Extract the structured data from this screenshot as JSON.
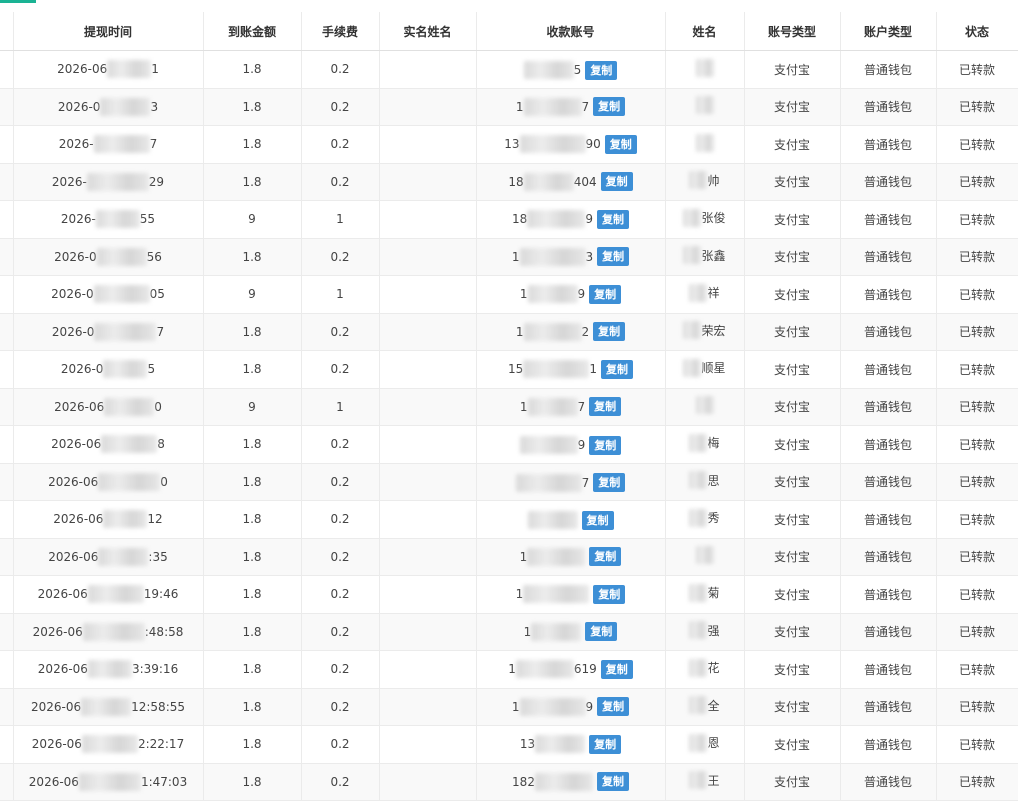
{
  "colors": {
    "accent": "#1ab394",
    "copy_button": "#3d8fd6"
  },
  "table": {
    "headers": [
      "提现时间",
      "到账金额",
      "手续费",
      "实名姓名",
      "收款账号",
      "姓名",
      "账号类型",
      "账户类型",
      "状态"
    ],
    "copy_label": "复制",
    "rows": [
      {
        "time_prefix": "2026-06",
        "time_suffix": "1",
        "amount": "1.8",
        "fee": "0.2",
        "real_name": "",
        "account_prefix": "",
        "account_suffix": "5",
        "name": "",
        "account_type": "支付宝",
        "wallet_type": "普通钱包",
        "status": "已转款"
      },
      {
        "time_prefix": "2026-0",
        "time_suffix": "3",
        "amount": "1.8",
        "fee": "0.2",
        "real_name": "",
        "account_prefix": "1",
        "account_suffix": "7",
        "name": "",
        "account_type": "支付宝",
        "wallet_type": "普通钱包",
        "status": "已转款"
      },
      {
        "time_prefix": "2026-",
        "time_suffix": "7",
        "amount": "1.8",
        "fee": "0.2",
        "real_name": "",
        "account_prefix": "13",
        "account_suffix": "90",
        "name": "",
        "account_type": "支付宝",
        "wallet_type": "普通钱包",
        "status": "已转款"
      },
      {
        "time_prefix": "2026-",
        "time_suffix": "29",
        "amount": "1.8",
        "fee": "0.2",
        "real_name": "",
        "account_prefix": "18",
        "account_suffix": "404",
        "name": "帅",
        "account_type": "支付宝",
        "wallet_type": "普通钱包",
        "status": "已转款"
      },
      {
        "time_prefix": "2026-",
        "time_suffix": "55",
        "amount": "9",
        "fee": "1",
        "real_name": "",
        "account_prefix": "18",
        "account_suffix": "9",
        "name": "张俊",
        "account_type": "支付宝",
        "wallet_type": "普通钱包",
        "status": "已转款"
      },
      {
        "time_prefix": "2026-0",
        "time_suffix": "56",
        "amount": "1.8",
        "fee": "0.2",
        "real_name": "",
        "account_prefix": "1",
        "account_suffix": "3",
        "name": "张鑫",
        "account_type": "支付宝",
        "wallet_type": "普通钱包",
        "status": "已转款"
      },
      {
        "time_prefix": "2026-0",
        "time_suffix": "05",
        "amount": "9",
        "fee": "1",
        "real_name": "",
        "account_prefix": "1",
        "account_suffix": "9",
        "name": "祥",
        "account_type": "支付宝",
        "wallet_type": "普通钱包",
        "status": "已转款"
      },
      {
        "time_prefix": "2026-0",
        "time_suffix": "7",
        "amount": "1.8",
        "fee": "0.2",
        "real_name": "",
        "account_prefix": "1",
        "account_suffix": "2",
        "name": "荣宏",
        "account_type": "支付宝",
        "wallet_type": "普通钱包",
        "status": "已转款"
      },
      {
        "time_prefix": "2026-0",
        "time_suffix": "5",
        "amount": "1.8",
        "fee": "0.2",
        "real_name": "",
        "account_prefix": "15",
        "account_suffix": "1",
        "name": "顺星",
        "account_type": "支付宝",
        "wallet_type": "普通钱包",
        "status": "已转款"
      },
      {
        "time_prefix": "2026-06",
        "time_suffix": "0",
        "amount": "9",
        "fee": "1",
        "real_name": "",
        "account_prefix": "1",
        "account_suffix": "7",
        "name": "",
        "account_type": "支付宝",
        "wallet_type": "普通钱包",
        "status": "已转款"
      },
      {
        "time_prefix": "2026-06",
        "time_suffix": "8",
        "amount": "1.8",
        "fee": "0.2",
        "real_name": "",
        "account_prefix": "",
        "account_suffix": "9",
        "name": "梅",
        "account_type": "支付宝",
        "wallet_type": "普通钱包",
        "status": "已转款"
      },
      {
        "time_prefix": "2026-06",
        "time_suffix": "0",
        "amount": "1.8",
        "fee": "0.2",
        "real_name": "",
        "account_prefix": "",
        "account_suffix": "7",
        "name": "思",
        "account_type": "支付宝",
        "wallet_type": "普通钱包",
        "status": "已转款"
      },
      {
        "time_prefix": "2026-06",
        "time_suffix": "12",
        "amount": "1.8",
        "fee": "0.2",
        "real_name": "",
        "account_prefix": "",
        "account_suffix": "",
        "name": "秀",
        "account_type": "支付宝",
        "wallet_type": "普通钱包",
        "status": "已转款"
      },
      {
        "time_prefix": "2026-06",
        "time_suffix": ":35",
        "amount": "1.8",
        "fee": "0.2",
        "real_name": "",
        "account_prefix": "1",
        "account_suffix": "",
        "name": "",
        "account_type": "支付宝",
        "wallet_type": "普通钱包",
        "status": "已转款"
      },
      {
        "time_prefix": "2026-06",
        "time_suffix": "19:46",
        "amount": "1.8",
        "fee": "0.2",
        "real_name": "",
        "account_prefix": "1",
        "account_suffix": "",
        "name": "菊",
        "account_type": "支付宝",
        "wallet_type": "普通钱包",
        "status": "已转款"
      },
      {
        "time_prefix": "2026-06",
        "time_suffix": ":48:58",
        "amount": "1.8",
        "fee": "0.2",
        "real_name": "",
        "account_prefix": "1",
        "account_suffix": "",
        "name": "强",
        "account_type": "支付宝",
        "wallet_type": "普通钱包",
        "status": "已转款"
      },
      {
        "time_prefix": "2026-06",
        "time_suffix": "3:39:16",
        "amount": "1.8",
        "fee": "0.2",
        "real_name": "",
        "account_prefix": "1",
        "account_suffix": "619",
        "name": "花",
        "account_type": "支付宝",
        "wallet_type": "普通钱包",
        "status": "已转款"
      },
      {
        "time_prefix": "2026-06",
        "time_suffix": "12:58:55",
        "amount": "1.8",
        "fee": "0.2",
        "real_name": "",
        "account_prefix": "1",
        "account_suffix": "9",
        "name": "全",
        "account_type": "支付宝",
        "wallet_type": "普通钱包",
        "status": "已转款"
      },
      {
        "time_prefix": "2026-06",
        "time_suffix": "2:22:17",
        "amount": "1.8",
        "fee": "0.2",
        "real_name": "",
        "account_prefix": "13",
        "account_suffix": "",
        "name": "恩",
        "account_type": "支付宝",
        "wallet_type": "普通钱包",
        "status": "已转款"
      },
      {
        "time_prefix": "2026-06",
        "time_suffix": "1:47:03",
        "amount": "1.8",
        "fee": "0.2",
        "real_name": "",
        "account_prefix": "182",
        "account_suffix": "",
        "name": "王",
        "account_type": "支付宝",
        "wallet_type": "普通钱包",
        "status": "已转款"
      }
    ]
  }
}
